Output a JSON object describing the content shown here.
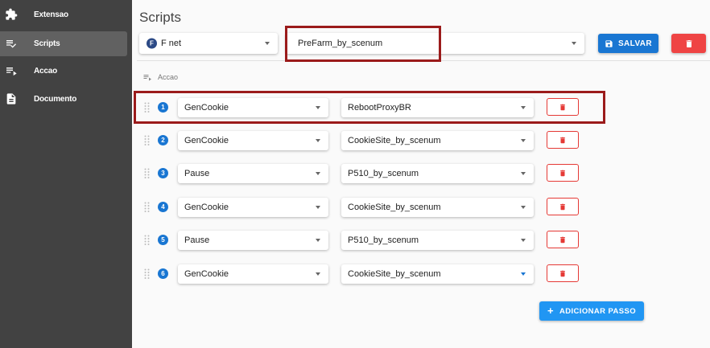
{
  "sidebar": {
    "items": [
      {
        "label": "Extensao",
        "icon": "puzzle-icon"
      },
      {
        "label": "Scripts",
        "icon": "playlist-check-icon",
        "active": true
      },
      {
        "label": "Accao",
        "icon": "playlist-play-icon"
      },
      {
        "label": "Documento",
        "icon": "document-icon"
      }
    ]
  },
  "header": {
    "title": "Scripts",
    "profile_chip": "F",
    "profile_value": "F net",
    "script_value": "PreFarm_by_scenum",
    "save_label": "SALVAR"
  },
  "section": {
    "label": "Accao"
  },
  "steps": [
    {
      "number": "1",
      "action": "GenCookie",
      "script": "RebootProxyBR"
    },
    {
      "number": "2",
      "action": "GenCookie",
      "script": "CookieSite_by_scenum"
    },
    {
      "number": "3",
      "action": "Pause",
      "script": "P510_by_scenum"
    },
    {
      "number": "4",
      "action": "GenCookie",
      "script": "CookieSite_by_scenum"
    },
    {
      "number": "5",
      "action": "Pause",
      "script": "P510_by_scenum"
    },
    {
      "number": "6",
      "action": "GenCookie",
      "script": "CookieSite_by_scenum"
    }
  ],
  "add_step_label": "ADICIONAR PASSO",
  "colors": {
    "sidebar_bg": "#424242",
    "primary": "#1976d2",
    "danger": "#ef4444",
    "highlight": "#9b1b1b"
  }
}
